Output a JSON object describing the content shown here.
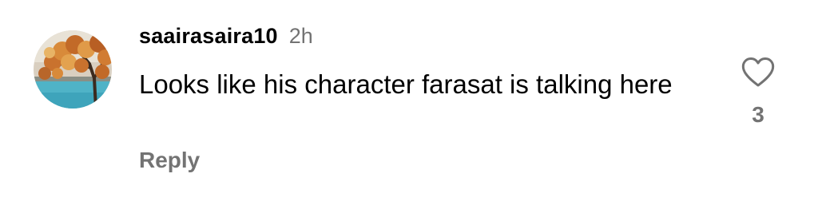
{
  "comment": {
    "author": {
      "username": "saairasaira10",
      "avatar_icon": "autumn-tree-avatar"
    },
    "timestamp": "2h",
    "text": "Looks like his character farasat is talking here",
    "reply_label": "Reply",
    "like": {
      "icon": "heart-icon",
      "count": "3"
    }
  },
  "colors": {
    "text": "#000000",
    "secondary": "#737373",
    "background": "#ffffff"
  }
}
